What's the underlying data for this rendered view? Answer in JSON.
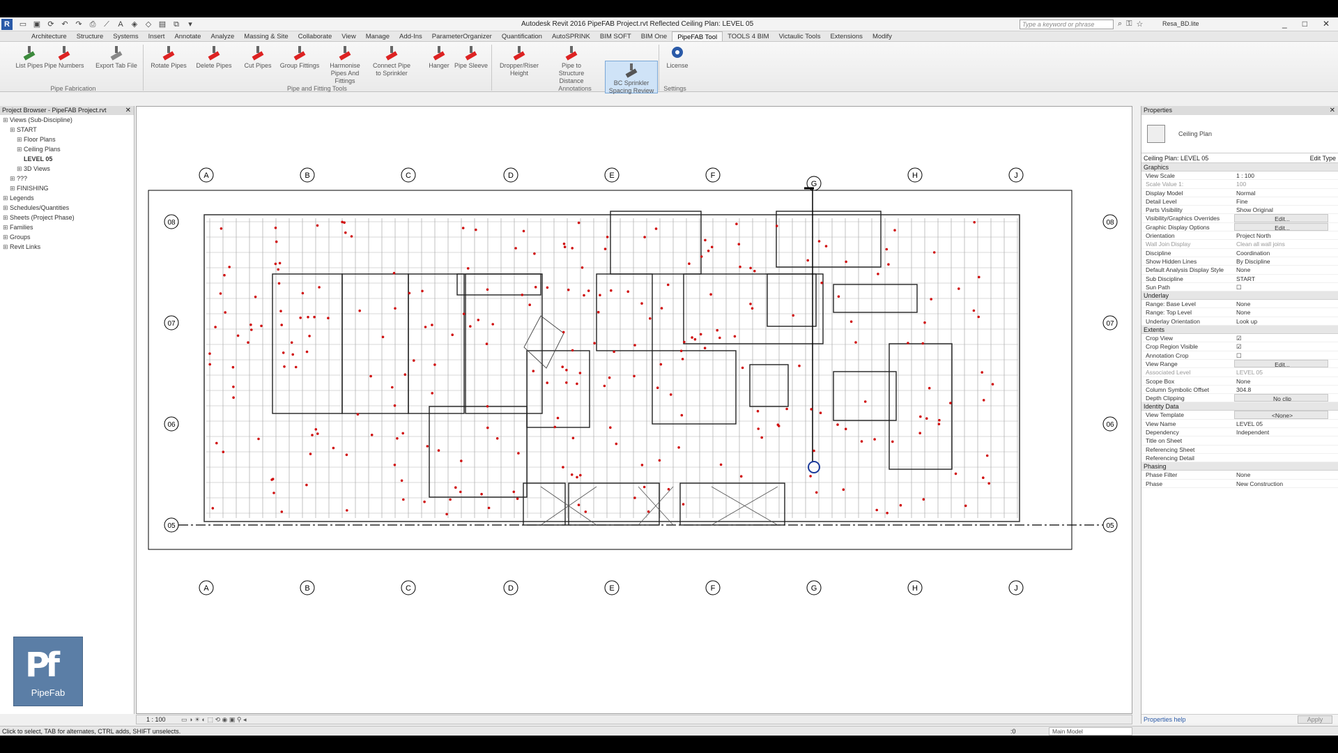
{
  "titlebar": {
    "app_initial": "R",
    "title": "Autodesk Revit 2016       PipeFAB Project.rvt    Reflected Ceiling Plan: LEVEL 05",
    "search_placeholder": "Type a keyword or phrase",
    "user": "Resa_BD.lite",
    "win_min": "_",
    "win_max": "□",
    "win_close": "✕"
  },
  "tabs": [
    "Architecture",
    "Structure",
    "Systems",
    "Insert",
    "Annotate",
    "Analyze",
    "Massing & Site",
    "Collaborate",
    "View",
    "Manage",
    "Add-Ins",
    "ParameterOrganizer",
    "Quantification",
    "AutoSPRINK",
    "BIM SOFT",
    "BIM One",
    "PipeFAB Tool",
    "TOOLS 4 BIM",
    "Victaulic Tools",
    "Extensions",
    "Modify"
  ],
  "active_tab": "PipeFAB Tool",
  "ribbon": {
    "buttons": [
      {
        "label": "List Pipes",
        "color": "#3c8a3c"
      },
      {
        "label": "Pipe Numbers",
        "color": "#d22"
      },
      {
        "label": "Export Tab File",
        "color": "#888"
      },
      {
        "label": "Rotate Pipes",
        "color": "#d22"
      },
      {
        "label": "Delete Pipes",
        "color": "#d22"
      },
      {
        "label": "Cut Pipes",
        "color": "#d22"
      },
      {
        "label": "Group Fittings",
        "color": "#d22"
      },
      {
        "label": "Harmonise Pipes And Fittings",
        "color": "#d22"
      },
      {
        "label": "Connect Pipe to Sprinkler",
        "color": "#d22"
      },
      {
        "label": "Hanger",
        "color": "#d22"
      },
      {
        "label": "Pipe Sleeve",
        "color": "#d22"
      },
      {
        "label": "Dropper/Riser Height",
        "color": "#d22"
      },
      {
        "label": "Pipe to Structure Distance",
        "color": "#d22"
      },
      {
        "label": "BC Sprinkler Spacing Review",
        "color": "#555"
      },
      {
        "label": "License",
        "color": "#2a5aa8"
      }
    ],
    "panels": [
      "Pipe Fabrication",
      "Pipe and Fitting Tools",
      "Annotations",
      "Settings"
    ]
  },
  "browser": {
    "title": "Project Browser - PipeFAB Project.rvt",
    "items": [
      {
        "label": "Views (Sub-Discipline)",
        "indent": 0,
        "bold": false
      },
      {
        "label": "START",
        "indent": 1,
        "bold": false
      },
      {
        "label": "Floor Plans",
        "indent": 2,
        "bold": false
      },
      {
        "label": "Ceiling Plans",
        "indent": 2,
        "bold": false
      },
      {
        "label": "LEVEL 05",
        "indent": 3,
        "bold": true
      },
      {
        "label": "3D Views",
        "indent": 2,
        "bold": false
      },
      {
        "label": "???",
        "indent": 1,
        "bold": false
      },
      {
        "label": "FINISHING",
        "indent": 1,
        "bold": false
      },
      {
        "label": "Legends",
        "indent": 0,
        "bold": false
      },
      {
        "label": "Schedules/Quantities",
        "indent": 0,
        "bold": false
      },
      {
        "label": "Sheets (Project Phase)",
        "indent": 0,
        "bold": false
      },
      {
        "label": "Families",
        "indent": 0,
        "bold": false
      },
      {
        "label": "Groups",
        "indent": 0,
        "bold": false
      },
      {
        "label": "Revit Links",
        "indent": 0,
        "bold": false
      }
    ]
  },
  "canvas": {
    "grid_columns": [
      "A",
      "B",
      "C",
      "D",
      "E",
      "F",
      "G",
      "H",
      "J"
    ],
    "grid_rows": [
      "08",
      "07",
      "06",
      "05"
    ]
  },
  "viewbar": {
    "scale": "1 : 100"
  },
  "props": {
    "title": "Properties",
    "type_name": "Ceiling Plan",
    "instance": "Ceiling Plan: LEVEL 05",
    "edit_type": "Edit Type",
    "groups": [
      {
        "name": "Graphics",
        "rows": [
          {
            "k": "View Scale",
            "v": "1 : 100"
          },
          {
            "k": "Scale Value    1:",
            "v": "100",
            "dim": true
          },
          {
            "k": "Display Model",
            "v": "Normal"
          },
          {
            "k": "Detail Level",
            "v": "Fine"
          },
          {
            "k": "Parts Visibility",
            "v": "Show Original"
          },
          {
            "k": "Visibility/Graphics Overrides",
            "v": "Edit...",
            "btn": true
          },
          {
            "k": "Graphic Display Options",
            "v": "Edit...",
            "btn": true
          },
          {
            "k": "Orientation",
            "v": "Project North"
          },
          {
            "k": "Wall Join Display",
            "v": "Clean all wall joins",
            "dim": true
          },
          {
            "k": "Discipline",
            "v": "Coordination"
          },
          {
            "k": "Show Hidden Lines",
            "v": "By Discipline"
          },
          {
            "k": "Default Analysis Display Style",
            "v": "None"
          },
          {
            "k": "Sub Discipline",
            "v": "START"
          },
          {
            "k": "Sun Path",
            "v": "☐"
          }
        ]
      },
      {
        "name": "Underlay",
        "rows": [
          {
            "k": "Range: Base Level",
            "v": "None"
          },
          {
            "k": "Range: Top Level",
            "v": "None"
          },
          {
            "k": "Underlay Orientation",
            "v": "Look up"
          }
        ]
      },
      {
        "name": "Extents",
        "rows": [
          {
            "k": "Crop View",
            "v": "☑"
          },
          {
            "k": "Crop Region Visible",
            "v": "☑"
          },
          {
            "k": "Annotation Crop",
            "v": "☐"
          },
          {
            "k": "View Range",
            "v": "Edit...",
            "btn": true
          },
          {
            "k": "Associated Level",
            "v": "LEVEL 05",
            "dim": true
          },
          {
            "k": "Scope Box",
            "v": "None"
          },
          {
            "k": "Column Symbolic Offset",
            "v": "304.8"
          },
          {
            "k": "Depth Clipping",
            "v": "No clip",
            "btn": true
          }
        ]
      },
      {
        "name": "Identity Data",
        "rows": [
          {
            "k": "View Template",
            "v": "<None>",
            "btn": true
          },
          {
            "k": "View Name",
            "v": "LEVEL 05"
          },
          {
            "k": "Dependency",
            "v": "Independent"
          },
          {
            "k": "Title on Sheet",
            "v": ""
          },
          {
            "k": "Referencing Sheet",
            "v": ""
          },
          {
            "k": "Referencing Detail",
            "v": ""
          }
        ]
      },
      {
        "name": "Phasing",
        "rows": [
          {
            "k": "Phase Filter",
            "v": "None"
          },
          {
            "k": "Phase",
            "v": "New Construction"
          }
        ]
      }
    ],
    "help": "Properties help",
    "apply": "Apply"
  },
  "status": {
    "hint": "Click to select, TAB for alternates, CTRL adds, SHIFT unselects.",
    "model": "Main Model",
    "sel_count": ":0"
  },
  "logo": {
    "mark": "Pf",
    "word": "PipeFab"
  }
}
